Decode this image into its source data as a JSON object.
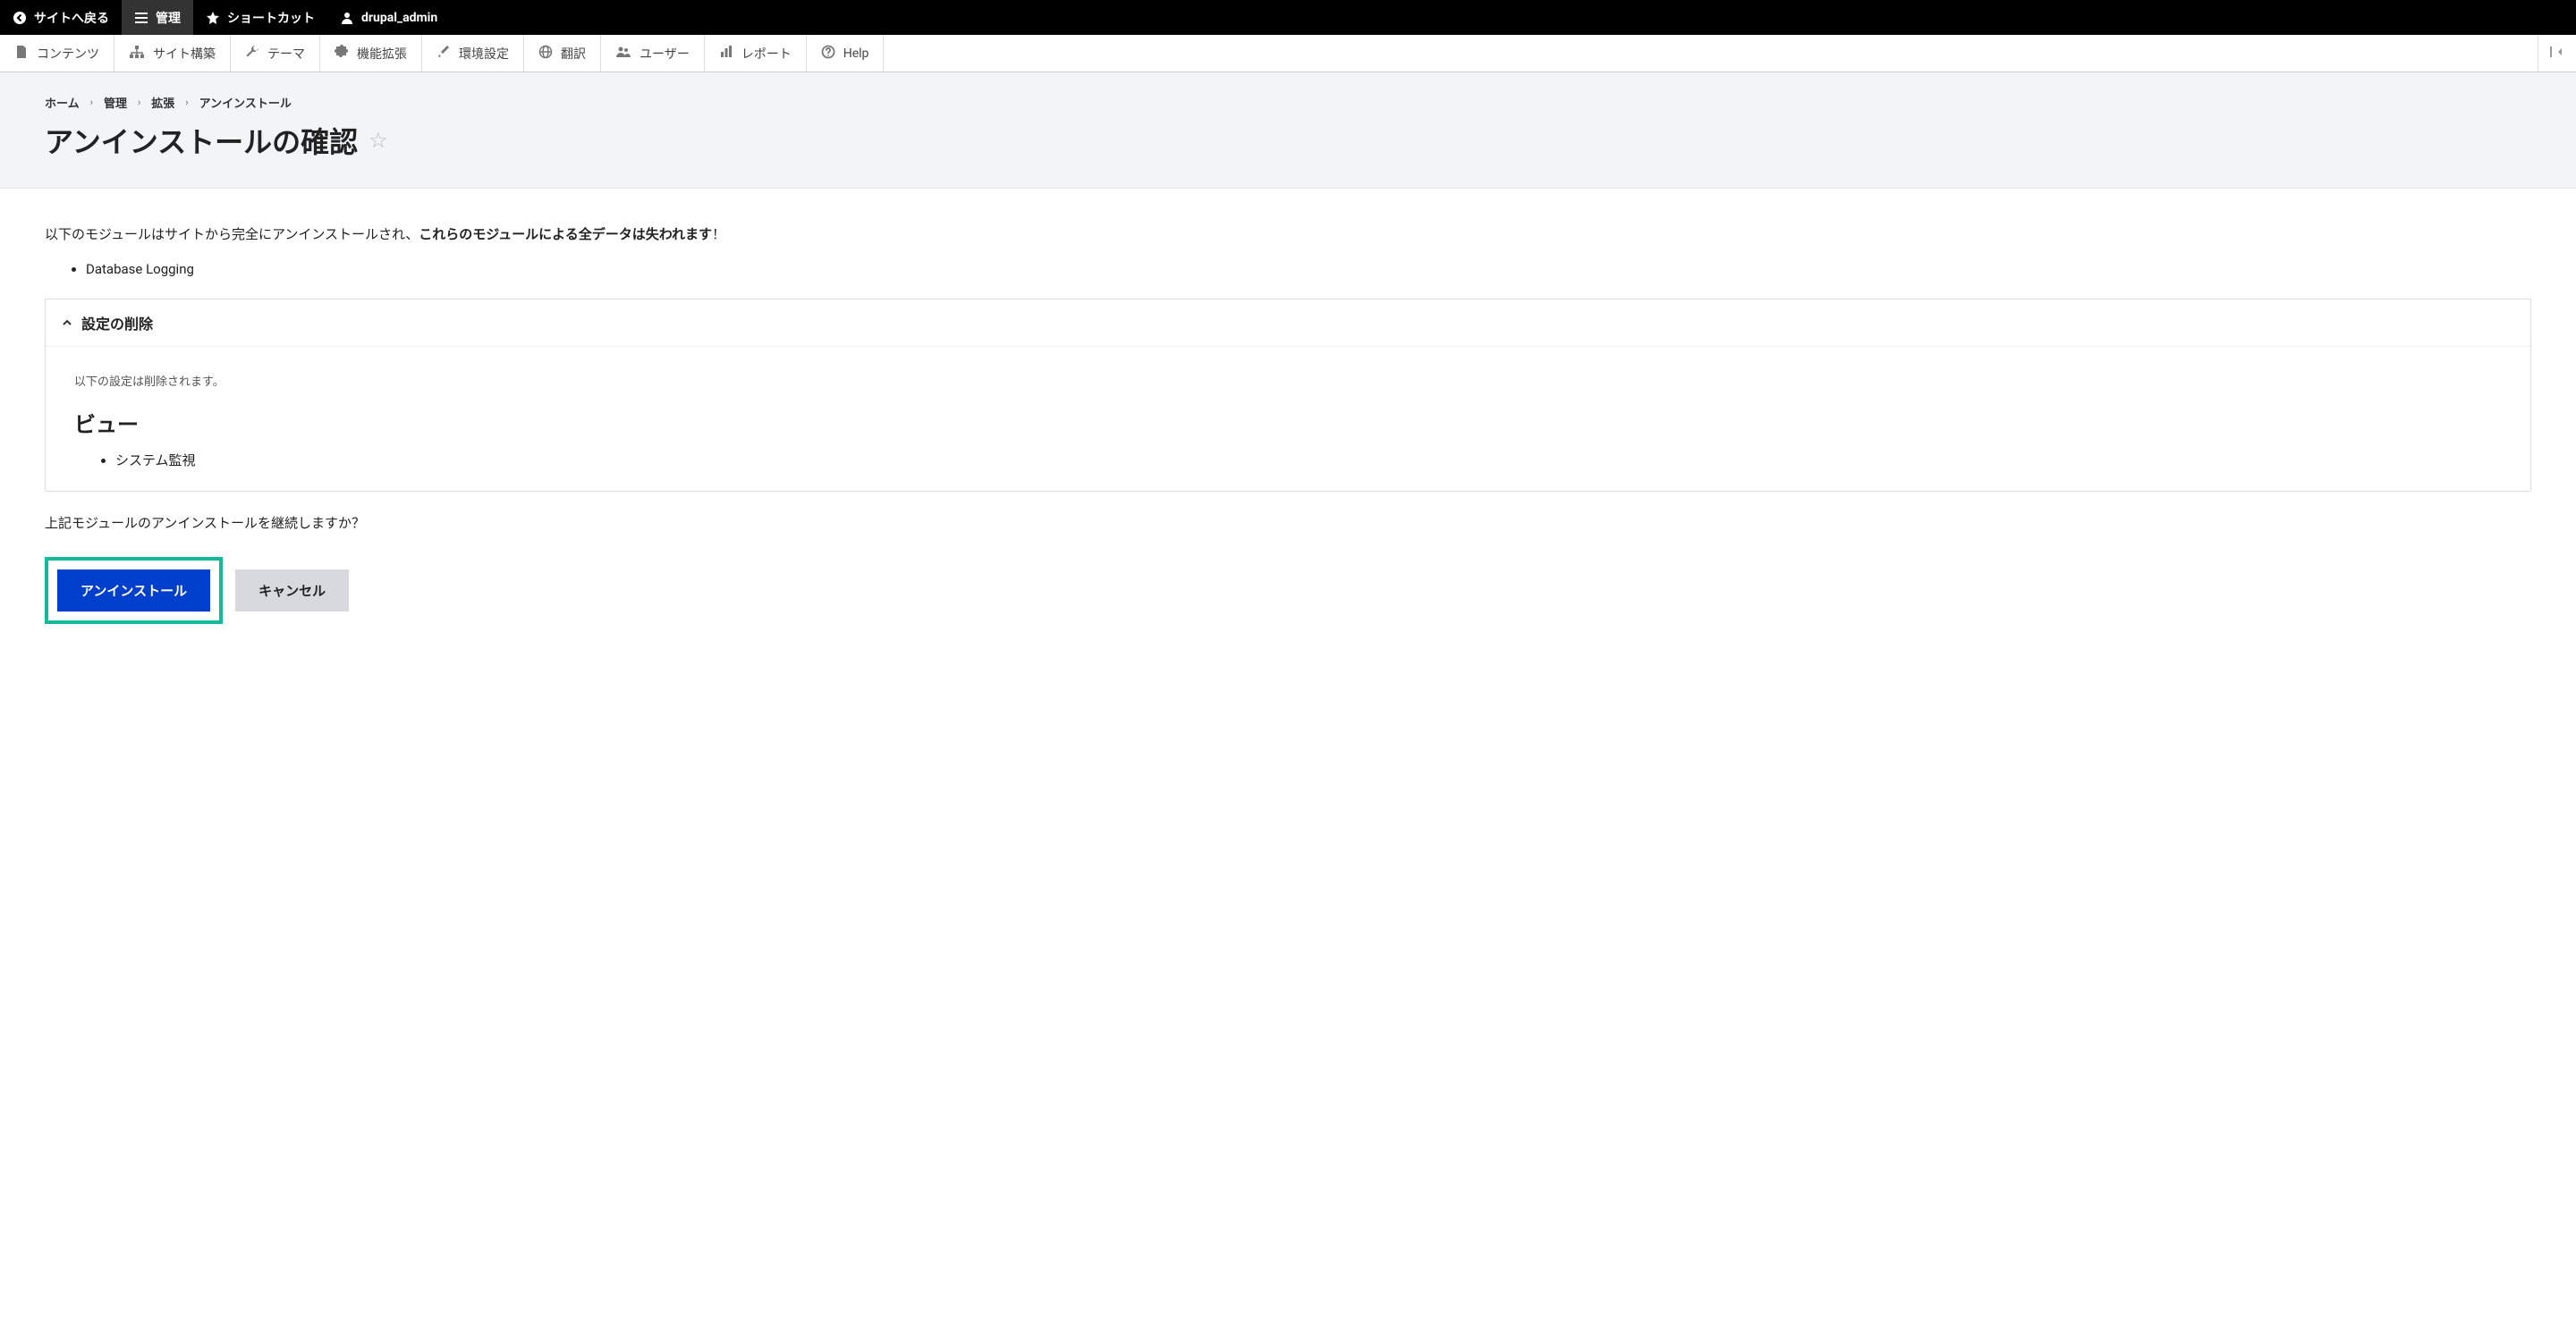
{
  "topbar": {
    "back": "サイトへ戻る",
    "manage": "管理",
    "shortcuts": "ショートカット",
    "user": "drupal_admin"
  },
  "adminMenu": {
    "content": "コンテンツ",
    "structure": "サイト構築",
    "appearance": "テーマ",
    "extend": "機能拡張",
    "config": "環境設定",
    "translate": "翻訳",
    "people": "ユーザー",
    "reports": "レポート",
    "help": "Help"
  },
  "breadcrumb": {
    "home": "ホーム",
    "admin": "管理",
    "extend": "拡張",
    "uninstall": "アンインストール"
  },
  "pageTitle": "アンインストールの確認",
  "intro": {
    "prefix": "以下のモジュールはサイトから完全にアンインストールされ、",
    "bold": "これらのモジュールによる全データは失われます",
    "suffix": "！"
  },
  "modules": [
    "Database Logging"
  ],
  "details": {
    "summary": "設定の削除",
    "note": "以下の設定は削除されます。",
    "heading": "ビュー",
    "items": [
      "システム監視"
    ]
  },
  "confirmText": "上記モジュールのアンインストールを継続しますか？",
  "buttons": {
    "uninstall": "アンインストール",
    "cancel": "キャンセル"
  }
}
